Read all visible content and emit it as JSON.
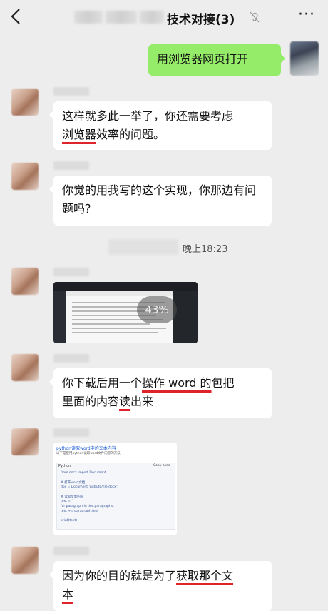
{
  "header": {
    "back_icon": "chevron-left-icon",
    "title": "技术对接(3)",
    "mute_icon": "ear-icon",
    "more_label": "···"
  },
  "messages": {
    "m1": "用浏览器网页打开",
    "m2_a": "这样就多此一举了，你还需要考虑",
    "m2_b1": "浏览器",
    "m2_b2": "效率的问题。",
    "m3": "你觉的用我写的这个实现，你那边有问题吗？",
    "m4_a1": "你下载后用一个",
    "m4_a2": "操作 word 的",
    "m4_a3": "包把",
    "m4_b1": "里面的内容",
    "m4_b2": "读",
    "m4_b3": "出来",
    "m5_a1": "因为你的目的就是为了",
    "m5_a2": "获取那个文",
    "m5_b": "本"
  },
  "timestamp": "晚上18:23",
  "image_message": {
    "progress_label": "43%"
  },
  "code_card": {
    "title": "python读取word中的文本内容",
    "subtitle": "以下是使用python读取word文件内容的方法",
    "language": "Python",
    "copy_label": "Copy code",
    "lines": [
      "from docx import Document",
      "",
      "# 打开word文档",
      "doc = Document('path/to/file.docx')",
      "",
      "# 读取文本内容",
      "text = ''",
      "for paragraph in doc.paragraphs:",
      "    text += paragraph.text",
      "",
      "print(text)"
    ]
  },
  "colors": {
    "accent_green": "#95ec69",
    "underline_red": "#e0232b",
    "background": "#ededed"
  }
}
